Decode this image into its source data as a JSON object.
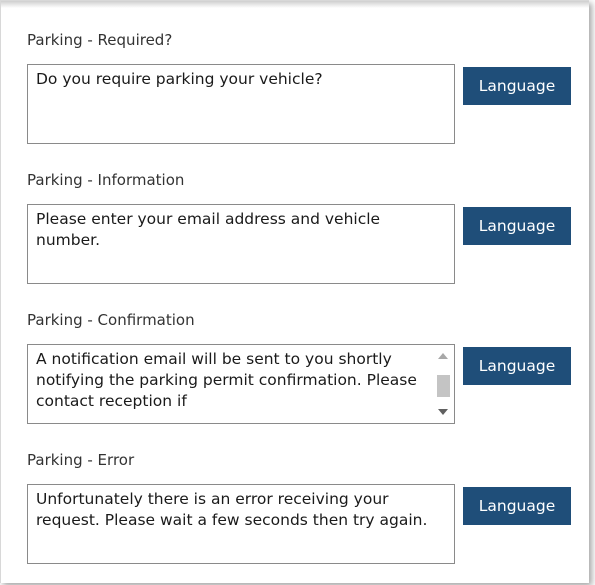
{
  "fields": [
    {
      "label": "Parking - Required?",
      "text": "Do you require parking your vehicle?",
      "button": "Language"
    },
    {
      "label": "Parking - Information",
      "text": "Please enter your email address and vehicle number.",
      "button": "Language"
    },
    {
      "label": "Parking - Confirmation",
      "text": "A notification email will be sent to you shortly  notifying the parking permit confirmation. Please contact reception if",
      "button": "Language"
    },
    {
      "label": "Parking - Error",
      "text": "Unfortunately there is an error receiving your request. Please wait a few seconds then try again.",
      "button": "Language"
    }
  ],
  "icons": {
    "scroll_up": "scroll-up-arrow",
    "scroll_down": "scroll-down-arrow"
  },
  "colors": {
    "button_bg": "#1f4e79",
    "button_text": "#ffffff",
    "textbox_border": "#8a8a8a"
  }
}
